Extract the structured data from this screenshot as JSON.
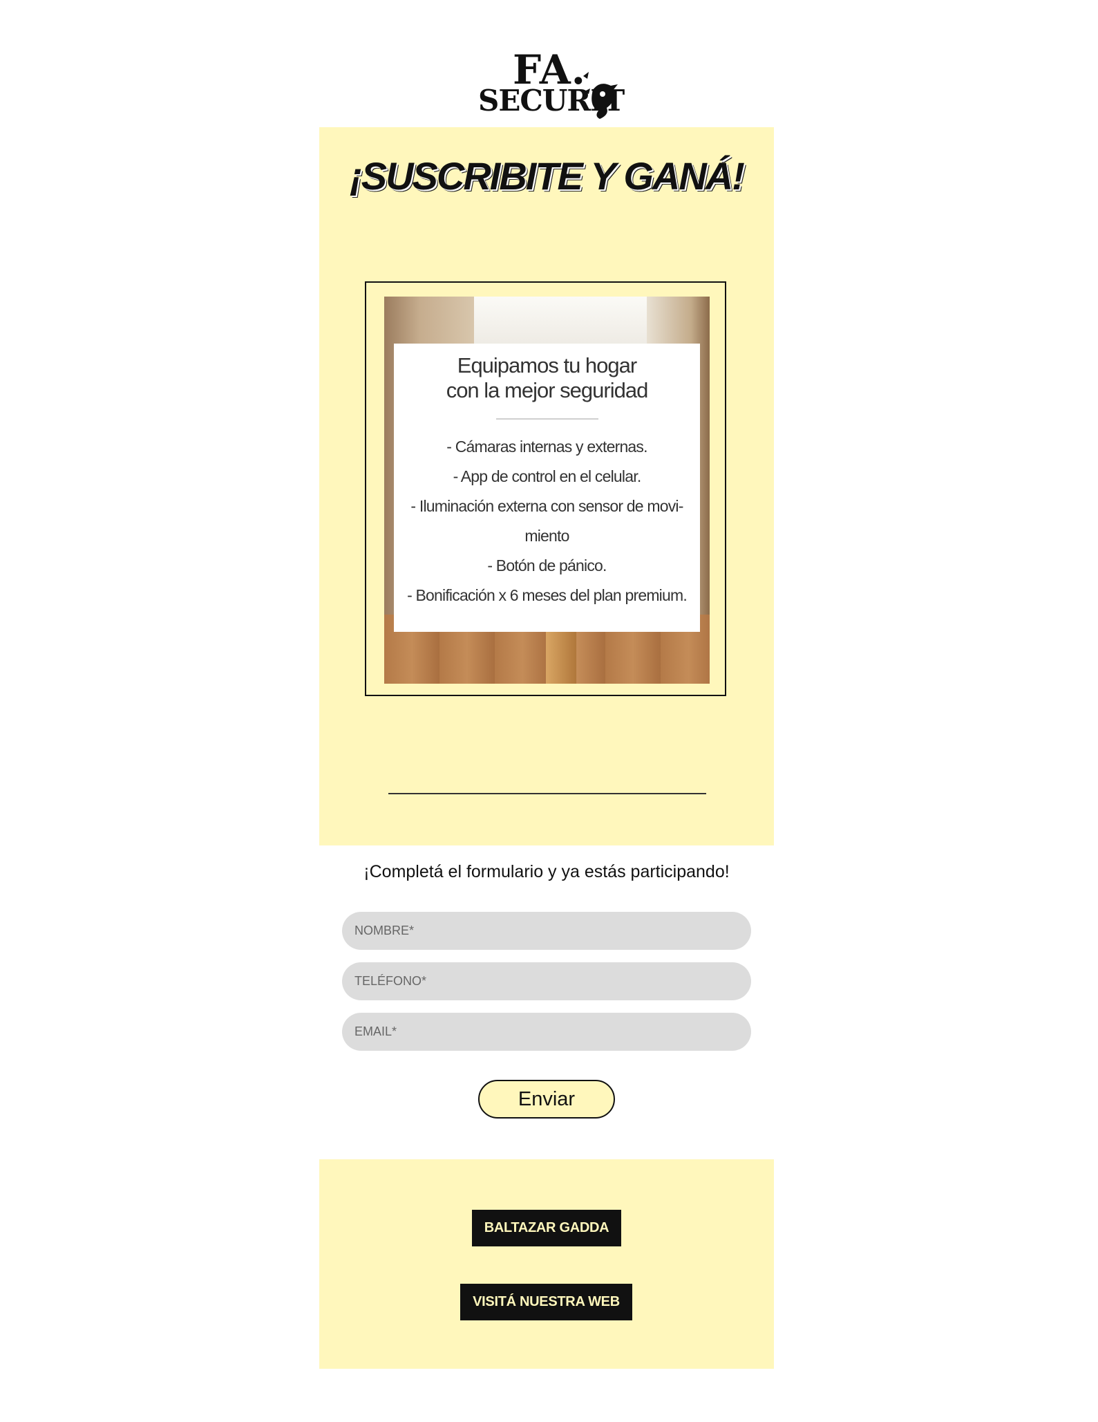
{
  "logo": {
    "line1": "FA.",
    "line2": "SECURIT"
  },
  "promo": {
    "title": "¡SUSCRIBITE Y GANÁ!",
    "card_heading_line1": "Equipamos tu hogar",
    "card_heading_line2": "con la mejor seguridad",
    "features": [
      "-  Cámaras internas y externas.",
      "-  App de control en el celular.",
      "-  Iluminación externa con sensor de movi-",
      "miento",
      "- Botón de pánico.",
      "- Bonificación x 6 meses del plan premium."
    ]
  },
  "form": {
    "intro": "¡Completá el formulario y ya estás participando!",
    "name_placeholder": "NOMBRE*",
    "phone_placeholder": "TELÉFONO*",
    "email_placeholder": "EMAIL*",
    "submit_label": "Enviar"
  },
  "footer": {
    "author_button": "BALTAZAR GADDA",
    "website_button": "VISITÁ NUESTRA WEB"
  },
  "colors": {
    "panel": "#fff7bc",
    "field": "#dcdcdc",
    "dark": "#111111"
  }
}
